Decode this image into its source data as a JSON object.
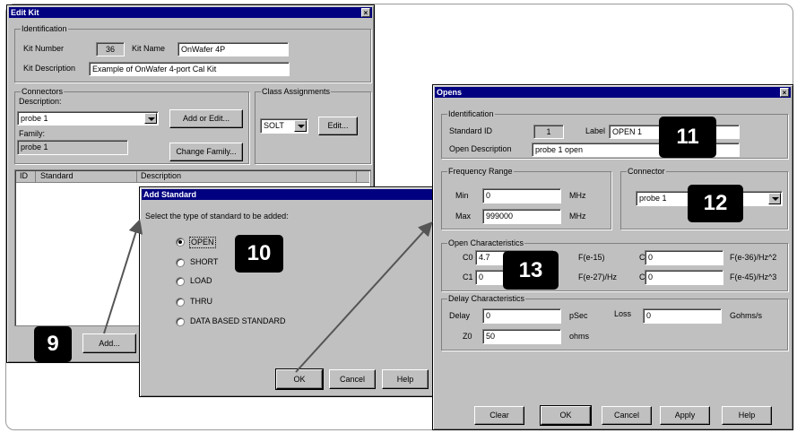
{
  "edit_kit": {
    "title": "Edit Kit",
    "close": "×",
    "identification": {
      "group": "Identification",
      "kit_number_label": "Kit Number",
      "kit_number_value": "36",
      "kit_name_label": "Kit Name",
      "kit_name_value": "OnWafer 4P",
      "kit_desc_label": "Kit Description",
      "kit_desc_value": "Example of OnWafer 4-port Cal Kit"
    },
    "connectors": {
      "group": "Connectors",
      "description_label": "Description:",
      "description_value": "probe 1",
      "add_edit_button": "Add or Edit...",
      "family_label": "Family:",
      "family_value": "probe 1",
      "change_family_button": "Change Family..."
    },
    "class_assignments": {
      "group": "Class Assignments",
      "value": "SOLT",
      "edit_button": "Edit..."
    },
    "table": {
      "columns": [
        "ID",
        "Standard",
        "Description"
      ]
    },
    "add_button": "Add..."
  },
  "add_standard": {
    "title": "Add Standard",
    "prompt": "Select the type of standard to be added:",
    "options": [
      "OPEN",
      "SHORT",
      "LOAD",
      "THRU",
      "DATA BASED STANDARD"
    ],
    "selected": "OPEN",
    "ok": "OK",
    "cancel": "Cancel",
    "help": "Help"
  },
  "opens": {
    "title": "Opens",
    "close": "×",
    "identification": {
      "group": "Identification",
      "standard_id_label": "Standard ID",
      "standard_id_value": "1",
      "label_label": "Label",
      "label_value": "OPEN 1",
      "open_desc_label": "Open Description",
      "open_desc_value": "probe 1  open"
    },
    "frequency_range": {
      "group": "Frequency Range",
      "min_label": "Min",
      "min_value": "0",
      "min_unit": "MHz",
      "max_label": "Max",
      "max_value": "999000",
      "max_unit": "MHz"
    },
    "connector": {
      "group": "Connector",
      "value": "probe 1"
    },
    "open_characteristics": {
      "group": "Open Characteristics",
      "c0_label": "C0",
      "c0_value": "4.7",
      "c0_unit": "F(e-15)",
      "c1_label": "C1",
      "c1_value": "0",
      "c1_unit": "F(e-27)/Hz",
      "c2_label": "C2",
      "c2_value": "0",
      "c2_unit": "F(e-36)/Hz^2",
      "c3_label": "C3",
      "c3_value": "0",
      "c3_unit": "F(e-45)/Hz^3"
    },
    "delay_characteristics": {
      "group": "Delay Characteristics",
      "delay_label": "Delay",
      "delay_value": "0",
      "delay_unit": "pSec",
      "loss_label": "Loss",
      "loss_value": "0",
      "loss_unit": "Gohms/s",
      "z0_label": "Z0",
      "z0_value": "50",
      "z0_unit": "ohms"
    },
    "buttons": [
      "Clear",
      "OK",
      "Cancel",
      "Apply",
      "Help"
    ]
  },
  "callouts": [
    "9",
    "10",
    "11",
    "12",
    "13"
  ]
}
